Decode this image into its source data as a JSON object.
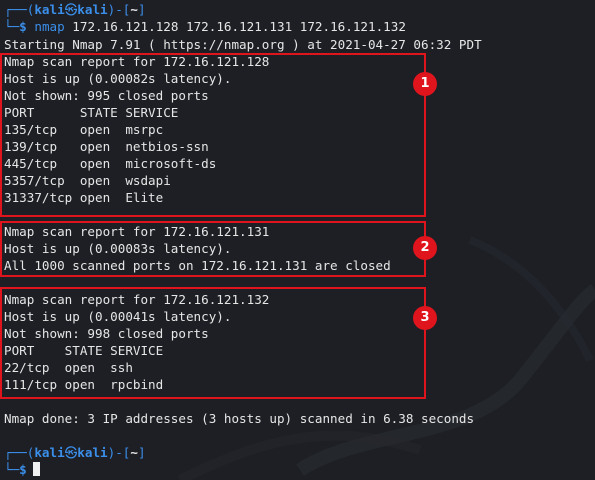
{
  "prompt": {
    "corner_top": "┌──(",
    "user": "kali",
    "at_symbol": "㉿",
    "host": "kali",
    "path_open": ")-[",
    "path": "~",
    "path_close": "]",
    "corner_bottom": "└─",
    "dollar": "$"
  },
  "command": {
    "program": "nmap",
    "args": " 172.16.121.128 172.16.121.131 172.16.121.132"
  },
  "output": {
    "starting": "Starting Nmap 7.91 ( https://nmap.org ) at 2021-04-27 06:32 PDT",
    "host1": {
      "report": "Nmap scan report for 172.16.121.128",
      "status": "Host is up (0.00082s latency).",
      "not_shown": "Not shown: 995 closed ports",
      "header": "PORT      STATE SERVICE",
      "ports": [
        "135/tcp   open  msrpc",
        "139/tcp   open  netbios-ssn",
        "445/tcp   open  microsoft-ds",
        "5357/tcp  open  wsdapi",
        "31337/tcp open  Elite"
      ]
    },
    "host2": {
      "report": "Nmap scan report for 172.16.121.131",
      "status": "Host is up (0.00083s latency).",
      "all_closed": "All 1000 scanned ports on 172.16.121.131 are closed"
    },
    "host3": {
      "report": "Nmap scan report for 172.16.121.132",
      "status": "Host is up (0.00041s latency).",
      "not_shown": "Not shown: 998 closed ports",
      "header": "PORT    STATE SERVICE",
      "ports": [
        "22/tcp  open  ssh",
        "111/tcp open  rpcbind"
      ]
    },
    "done": "Nmap done: 3 IP addresses (3 hosts up) scanned in 6.38 seconds"
  },
  "annotations": {
    "badge1": "1",
    "badge2": "2",
    "badge3": "3",
    "color": "#e0141c"
  }
}
